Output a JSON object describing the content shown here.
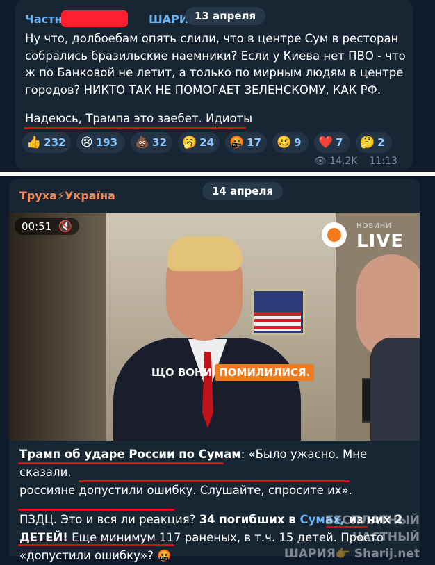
{
  "post1": {
    "channel_prefix": "Частны",
    "channel_suffix": "ШАРИЯ",
    "date": "13 апреля",
    "text_lines": [
      "Ну что, долбоебам опять слили, что в центре Сум в ресторан",
      "собрались бразильские наемники? Если у Киева нет ПВО - что",
      "ж по Банковой не летит, а только по мирным людям в центре",
      "городов? НИКТО ТАК НЕ ПОМОГАЕТ ЗЕЛЕНСКОМУ, КАК РФ."
    ],
    "closing_line": "Надеюсь, Трампа это заебет. Идиоты",
    "reactions": [
      {
        "emoji": "👍",
        "count": "232"
      },
      {
        "emoji": "😢",
        "count": "193"
      },
      {
        "emoji": "💩",
        "count": "32"
      },
      {
        "emoji": "🥱",
        "count": "24"
      },
      {
        "emoji": "🤬",
        "count": "17"
      },
      {
        "emoji": "🥴",
        "count": "9"
      },
      {
        "emoji": "❤️",
        "count": "7"
      },
      {
        "emoji": "🤔",
        "count": "2"
      }
    ],
    "views": "14.2K",
    "time": "11:13"
  },
  "post2": {
    "channel_name": "Труха⚡Україна",
    "date": "14 апреля",
    "video": {
      "timer": "00:51",
      "news_label": "НОВИНИ",
      "live_label": "LIVE",
      "subtitle_plain": "ЩО ВОНИ",
      "subtitle_highlight": "ПОМИЛИЛИСЯ.",
      "progress": 0.07
    },
    "para1": {
      "a": "Трамп об ударе России по Сумам",
      "b": ": «Было ужасно. Мне сказали,",
      "c": "россияне допустили ошибку. Слушайте, спросите их»."
    },
    "para2": {
      "a": "ПЗДЦ. Это и вся ли реакция? ",
      "b": "34 погибших в ",
      "c": "Сумах,",
      "d": " из них 2",
      "e": "ДЕТЕЙ!",
      "f": " Еще минимум 117 раненых, в т.ч. 15 детей. Просто",
      "g": "«допустили ошибку»? 🤬"
    },
    "watermark_line1": "БЕСПЛАТНЫЙ ЧАСТНЫЙ",
    "watermark_line2": "ШАРИЯ👉 Sharij.net"
  },
  "colors": {
    "background": "#0f1b2a",
    "panel": "#182533",
    "channel1": "#6ab3f3",
    "channel2": "#f08a5d",
    "underline": "#e30613",
    "link": "#6ab3f3"
  }
}
